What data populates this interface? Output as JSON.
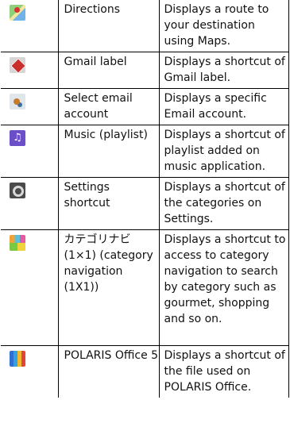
{
  "rows": [
    {
      "icon": "maps-icon",
      "name": "Directions",
      "description": "Displays a route to your destination using Maps."
    },
    {
      "icon": "gmail-label-icon",
      "name": "Gmail label",
      "description": "Displays a shortcut of Gmail label."
    },
    {
      "icon": "email-account-icon",
      "name": "Select email account",
      "description": "Displays a specific Email account."
    },
    {
      "icon": "music-playlist-icon",
      "name": "Music (playlist)",
      "description": "Displays a shortcut of playlist added on music application."
    },
    {
      "icon": "settings-icon",
      "name": "Settings shortcut",
      "description": "Displays a shortcut of the categories on Settings."
    },
    {
      "icon": "category-navigation-icon",
      "name": "カテゴリナビ (1×1) (category navigation (1X1))",
      "description": "Displays a shortcut to access to category navigation to search by category such as gourmet, shopping and so on."
    },
    {
      "icon": "polaris-office-icon",
      "name": "POLARIS Office 5",
      "description": "Displays a shortcut of the file used on POLARIS Office."
    }
  ]
}
